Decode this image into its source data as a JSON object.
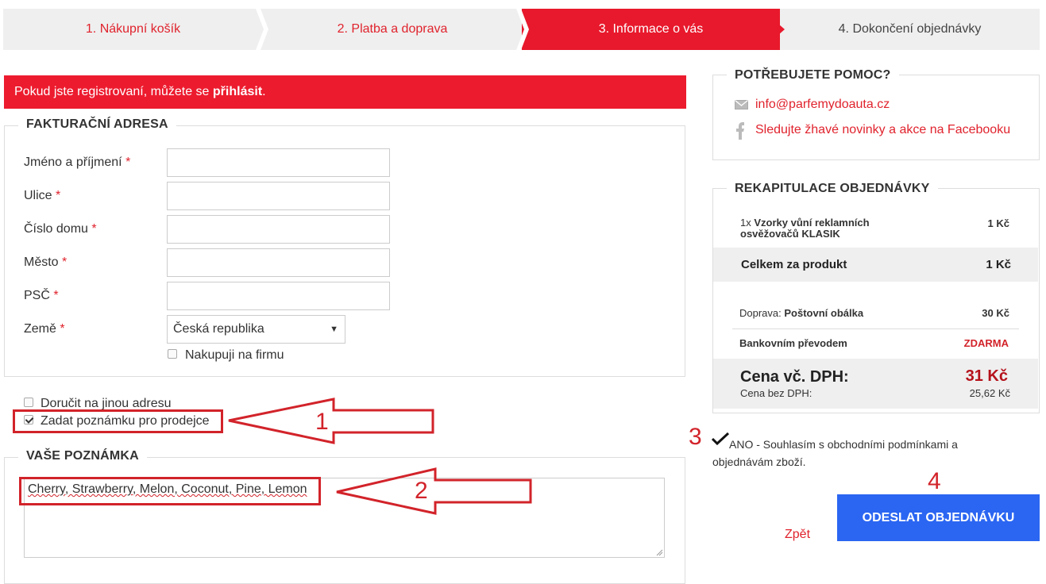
{
  "steps": [
    {
      "label": "1. Nákupní košík"
    },
    {
      "label": "2. Platba a doprava"
    },
    {
      "label": "3. Informace o vás"
    },
    {
      "label": "4. Dokončení objednávky"
    }
  ],
  "login": {
    "text": "Pokud jste registrovaní, můžete se ",
    "link": "přihlásit",
    "end": "."
  },
  "billing": {
    "title": "FAKTURAČNÍ ADRESA",
    "fields": {
      "name": "Jméno a příjmení",
      "street": "Ulice",
      "house": "Číslo domu",
      "city": "Město",
      "zip": "PSČ",
      "country": "Země"
    },
    "required_mark": "*",
    "country_value": "Česká republika",
    "company_label": "Nakupuji na firmu"
  },
  "options": {
    "other_address": "Doručit na jinou adresu",
    "note_to_seller": "Zadat poznámku pro prodejce"
  },
  "note": {
    "title": "VAŠE POZNÁMKA",
    "value": "Cherry, Strawberry, Melon, Coconut, Pine, Lemon"
  },
  "help": {
    "title": "POTŘEBUJETE POMOC?",
    "email": "info@parfemydoauta.cz",
    "facebook": "Sledujte žhavé novinky a akce na Facebooku"
  },
  "recap": {
    "title": "REKAPITULACE OBJEDNÁVKY",
    "item_qty": "1x",
    "item_name_1": "Vzorky vůní reklamních",
    "item_name_2": "osvěžovačů KLASIK",
    "item_price": "1 Kč",
    "product_total_label": "Celkem za produkt",
    "product_total": "1 Kč",
    "shipping_label": "Doprava:",
    "shipping_method": "Poštovní obálka",
    "shipping_price": "30 Kč",
    "payment_label": "Bankovním převodem",
    "payment_price": "ZDARMA",
    "total_label": "Cena vč. DPH:",
    "total_value": "31 Kč",
    "net_label": "Cena bez DPH:",
    "net_value": "25,62 Kč"
  },
  "terms": {
    "line1": "ANO - Souhlasím s obchodními podmínkami a",
    "line2": "objednávám zboží."
  },
  "actions": {
    "back": "Zpět",
    "submit": "ODESLAT OBJEDNÁVKU"
  },
  "annotations": {
    "a1": "1",
    "a2": "2",
    "a3": "3",
    "a4": "4"
  },
  "colors": {
    "accent": "#e8192c",
    "submit": "#2b66f2",
    "annotation": "#d2232a"
  }
}
